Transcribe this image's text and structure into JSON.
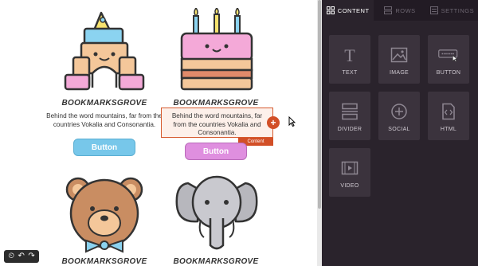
{
  "cards": [
    {
      "title": "BOOKMARKSGROVE",
      "text": "Behind the word mountains, far from the countries Vokalia and Consonantia.",
      "button": "Button",
      "button_color": "#77c7ea"
    },
    {
      "title": "BOOKMARKSGROVE",
      "text": "Behind the word mountains, far from the countries Vokalia and Consonantia.",
      "button": "Button",
      "button_color": "#df8fdf"
    },
    {
      "title": "BOOKMARKSGROVE"
    },
    {
      "title": "BOOKMARKSGROVE"
    }
  ],
  "selection": {
    "tag": "Content",
    "handle": "+"
  },
  "panel": {
    "tabs": [
      {
        "label": "CONTENT",
        "icon": "grid-icon",
        "active": true
      },
      {
        "label": "ROWS",
        "icon": "rows-icon",
        "active": false
      },
      {
        "label": "SETTINGS",
        "icon": "settings-icon",
        "active": false
      }
    ],
    "tiles": [
      {
        "label": "TEXT",
        "icon": "text-icon"
      },
      {
        "label": "IMAGE",
        "icon": "image-icon"
      },
      {
        "label": "BUTTON",
        "icon": "button-icon"
      },
      {
        "label": "DIVIDER",
        "icon": "divider-icon"
      },
      {
        "label": "SOCIAL",
        "icon": "social-icon"
      },
      {
        "label": "HTML",
        "icon": "html-icon"
      },
      {
        "label": "VIDEO",
        "icon": "video-icon"
      }
    ]
  },
  "colors": {
    "panel_bg": "#2a232c",
    "tile_bg": "#3b333d",
    "accent": "#d24f27"
  }
}
